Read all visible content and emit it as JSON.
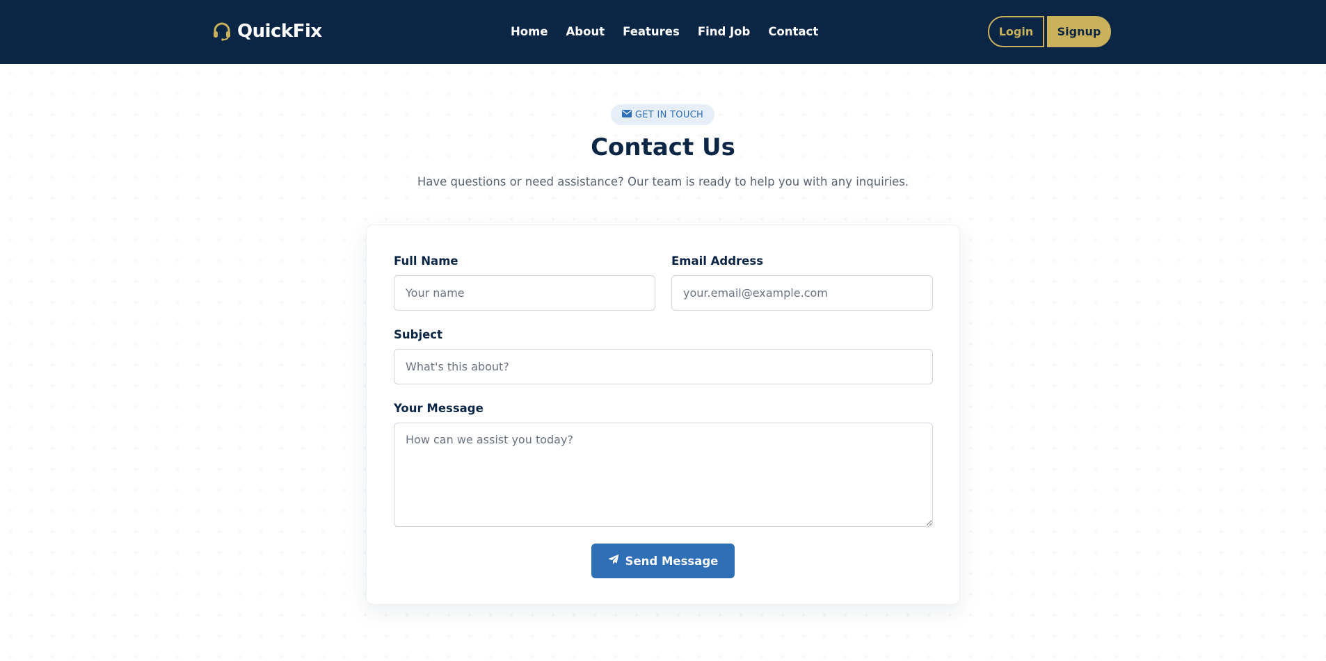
{
  "brand": {
    "name": "QuickFix",
    "icon": "headset-icon",
    "accent_color": "#c9b25b"
  },
  "nav": {
    "links": [
      "Home",
      "About",
      "Features",
      "Find Job",
      "Contact"
    ],
    "login_label": "Login",
    "signup_label": "Signup",
    "background_color": "#0b2545"
  },
  "hero": {
    "badge_icon": "envelope-icon",
    "badge_label": "GET IN TOUCH",
    "title": "Contact Us",
    "subtitle": "Have questions or need assistance? Our team is ready to help you with any inquiries."
  },
  "form": {
    "full_name": {
      "label": "Full Name",
      "placeholder": "Your name",
      "value": ""
    },
    "email": {
      "label": "Email Address",
      "placeholder": "your.email@example.com",
      "value": ""
    },
    "subject": {
      "label": "Subject",
      "placeholder": "What's this about?",
      "value": ""
    },
    "message": {
      "label": "Your Message",
      "placeholder": "How can we assist you today?",
      "value": ""
    },
    "submit_label": "Send Message",
    "submit_icon": "paper-plane-icon",
    "submit_color": "#2e6fb5"
  }
}
